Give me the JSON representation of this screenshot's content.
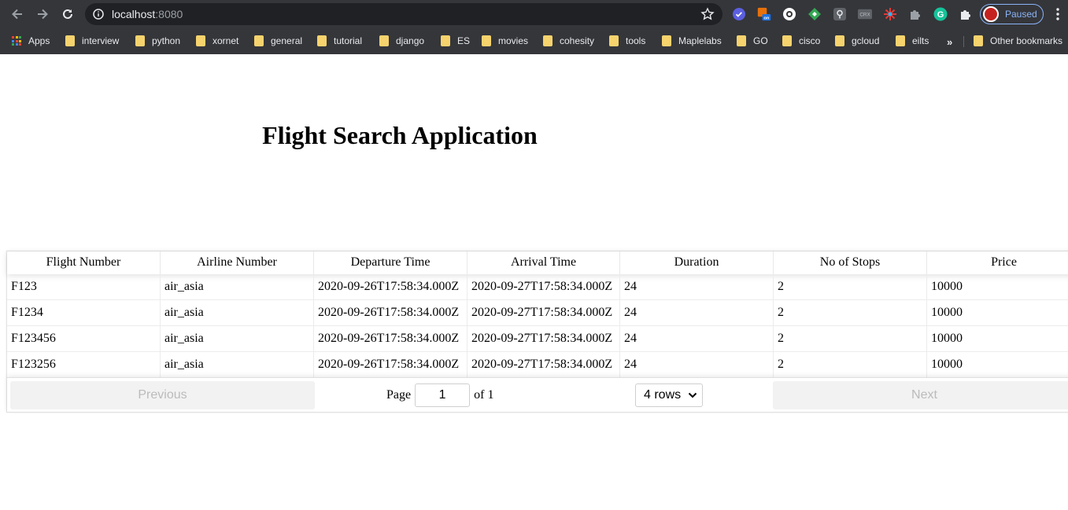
{
  "browser": {
    "url_host": "localhost",
    "url_port": ":8080",
    "profile_label": "Paused",
    "extensions": [
      "check-circle-icon",
      "on-badge-icon",
      "circle-dots-icon",
      "diamond-icon",
      "location-pin-icon",
      "crx-icon",
      "sparkle-icon",
      "puzzle-icon",
      "grammarly-icon",
      "extensions-icon"
    ],
    "bookmarks": [
      {
        "label": "Apps",
        "type": "apps"
      },
      {
        "label": "interview",
        "type": "folder"
      },
      {
        "label": "python",
        "type": "folder"
      },
      {
        "label": "xornet",
        "type": "folder"
      },
      {
        "label": "general",
        "type": "folder"
      },
      {
        "label": "tutorial",
        "type": "folder"
      },
      {
        "label": "django",
        "type": "folder"
      },
      {
        "label": "ES",
        "type": "folder"
      },
      {
        "label": "movies",
        "type": "folder"
      },
      {
        "label": "cohesity",
        "type": "folder"
      },
      {
        "label": "tools",
        "type": "folder"
      },
      {
        "label": "Maplelabs",
        "type": "folder"
      },
      {
        "label": "GO",
        "type": "folder"
      },
      {
        "label": "cisco",
        "type": "folder"
      },
      {
        "label": "gcloud",
        "type": "folder"
      },
      {
        "label": "eilts",
        "type": "folder"
      }
    ],
    "more_bookmarks": "»",
    "other_bookmarks": "Other bookmarks"
  },
  "page": {
    "title": "Flight Search Application"
  },
  "table": {
    "columns": [
      "Flight Number",
      "Airline Number",
      "Departure Time",
      "Arrival Time",
      "Duration",
      "No of Stops",
      "Price"
    ],
    "rows": [
      [
        "F123",
        "air_asia",
        "2020-09-26T17:58:34.000Z",
        "2020-09-27T17:58:34.000Z",
        "24",
        "2",
        "10000"
      ],
      [
        "F1234",
        "air_asia",
        "2020-09-26T17:58:34.000Z",
        "2020-09-27T17:58:34.000Z",
        "24",
        "2",
        "10000"
      ],
      [
        "F123456",
        "air_asia",
        "2020-09-26T17:58:34.000Z",
        "2020-09-27T17:58:34.000Z",
        "24",
        "2",
        "10000"
      ],
      [
        "F123256",
        "air_asia",
        "2020-09-26T17:58:34.000Z",
        "2020-09-27T17:58:34.000Z",
        "24",
        "2",
        "10000"
      ]
    ]
  },
  "pagination": {
    "previous_label": "Previous",
    "next_label": "Next",
    "page_label": "Page",
    "page_value": "1",
    "of_label": "of 1",
    "rows_value": "4 rows"
  },
  "colors": {
    "chrome_bg": "#35363a",
    "omnibox_bg": "#202124",
    "folder": "#f6d36d",
    "profile_accent": "#8ab4f8",
    "disabled_text": "#bbbbbb"
  }
}
